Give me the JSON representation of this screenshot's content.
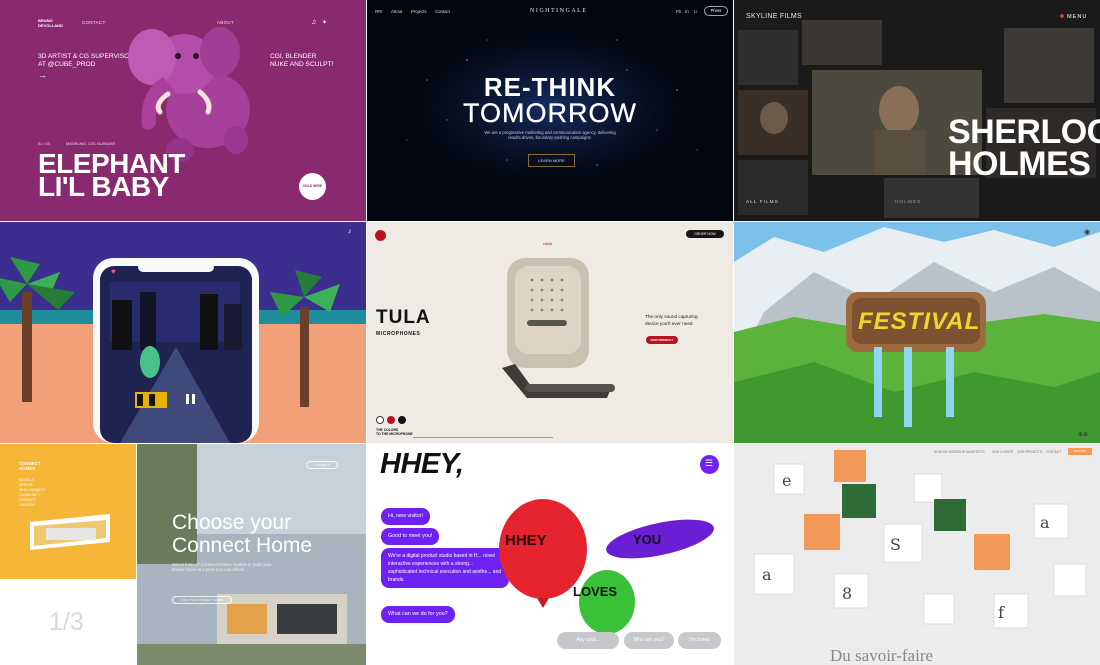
{
  "tile1": {
    "brand": "BRUNO\nDEVOLLAND",
    "nav": [
      "CONTACT",
      "ABOUT"
    ],
    "intro": "3D ARTIST & CG SUPERVISOR\nAT @CUBE_PROD",
    "skills": "CGI, BLENDER\nNUKE AND SCULPT!",
    "counter": "01 / 03",
    "tags": "MODELING, CGI, BLENDER",
    "title": "ELEPHANT\nLI'L BABY",
    "hold_button": "HOLD HERE",
    "colors": {
      "bg": "#8a2a6e",
      "elephant": "#b04aa6"
    }
  },
  "tile2": {
    "nav": [
      "RRI",
      "About",
      "Projects",
      "Contact"
    ],
    "logo": "NIGHTINGALE",
    "social": [
      "Fb",
      "In",
      "Li"
    ],
    "press": "Press",
    "headline": "RE-THINK",
    "headline2": "TOMORROW",
    "subtitle": "We are a progressive marketing and communication agency, delivering results-driven, boundary-pushing campaigns.",
    "cta": "LEARN MORE"
  },
  "tile3": {
    "brand": "SKYLINE FILMS",
    "menu": "MENU",
    "title": "SHERLOCK\nHOLMES",
    "all_films": "ALL FILMS",
    "selected": "HOLMES"
  },
  "tile5": {
    "signature": "vitula",
    "order": "ORDER NOW",
    "title": "TULA",
    "subtitle": "MICROPHONES",
    "description": "The only sound capturing device you'll ever need",
    "cta": "FIND PRODUCT",
    "colors_label": "THE COLORS\nTO THE MICROPHONE",
    "swatch_colors": [
      "#ffffff",
      "#b8141e",
      "#111111"
    ]
  },
  "tile7": {
    "brand": "CONNECT\nHOMES",
    "nav": [
      "MODELS",
      "DESIGN",
      "WHY CONNECT",
      "COMMUNITY",
      "CONTACT",
      "GALLERY"
    ],
    "headline": "Choose your\nConnect Home",
    "body": "Select from 10 Connect Homes models to build your dream home at a price you can afford.",
    "button": "FIND YOUR CONNECT HOME",
    "button2": "CONNECT",
    "pager": "1/3"
  },
  "tile8": {
    "logo": "HHEY,",
    "bubbles": [
      "Hi, new visitor!",
      "Good to meet you!",
      "We're a digital product studio based in H... novel interactive experiences with a strong... sophisticated technical execution and aesthe... and brands.",
      "What can we do for you?"
    ],
    "balloon_words": [
      "HHEY",
      "YOU",
      "LOVES"
    ],
    "chips": [
      "Any cool...",
      "Who are you?",
      "I'm bored"
    ],
    "accent": "#6e22f2"
  },
  "tile9": {
    "nav": [
      "HOW WE WORK",
      "OUR MANIFESTO",
      "OUR CLIENTS",
      "OUR PROJECTS",
      "CONTACT"
    ],
    "cta": "ENGLISH",
    "footer": "Du savoir-faire",
    "accent": "#f29a55"
  }
}
